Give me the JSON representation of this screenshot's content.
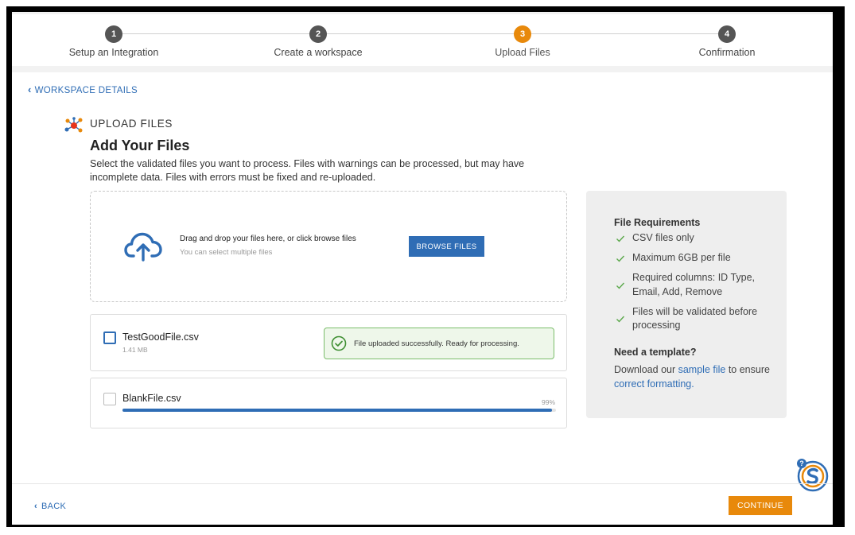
{
  "stepper": {
    "steps": [
      {
        "number": "1",
        "label": "Setup an Integration"
      },
      {
        "number": "2",
        "label": "Create a workspace"
      },
      {
        "number": "3",
        "label": "Upload Files"
      },
      {
        "number": "4",
        "label": "Confirmation"
      }
    ],
    "active_step": "3"
  },
  "nav": {
    "back_link": "WORKSPACE DETAILS"
  },
  "section": {
    "icon": "molecule-icon",
    "title": "UPLOAD FILES",
    "heading": "Add Your Files",
    "description": "Select the validated files you want to process. Files with warnings can be processed, but may have incomplete data. Files with errors must be fixed and re-uploaded."
  },
  "dropzone": {
    "icon": "cloud-upload-icon",
    "text": "Drag and drop your files here, or click browse files",
    "subtext": "You can select multiple files",
    "browse_label": "BROWSE FILES"
  },
  "files": [
    {
      "name": "TestGoodFile.csv",
      "size": "1.41 MB",
      "status": "File uploaded successfully. Ready for processing."
    },
    {
      "name": "BlankFile.csv",
      "progress_label": "99%",
      "progress": 0.99
    }
  ],
  "requirements": {
    "title": "File Requirements",
    "items": [
      "CSV files only",
      "Maximum 6GB per file",
      "Required columns: ID Type, Email, Add, Remove",
      "Files will be validated before processing"
    ],
    "template_title": "Need a template?",
    "template_pre": "Download our ",
    "template_link1": "sample file",
    "template_mid": " to ensure ",
    "template_link2": "correct formatting."
  },
  "footer": {
    "back_label": "BACK",
    "continue_label": "CONTINUE"
  },
  "colors": {
    "accent": "#e8890b",
    "primary": "#2f6db5",
    "success": "#7bbd6b"
  }
}
